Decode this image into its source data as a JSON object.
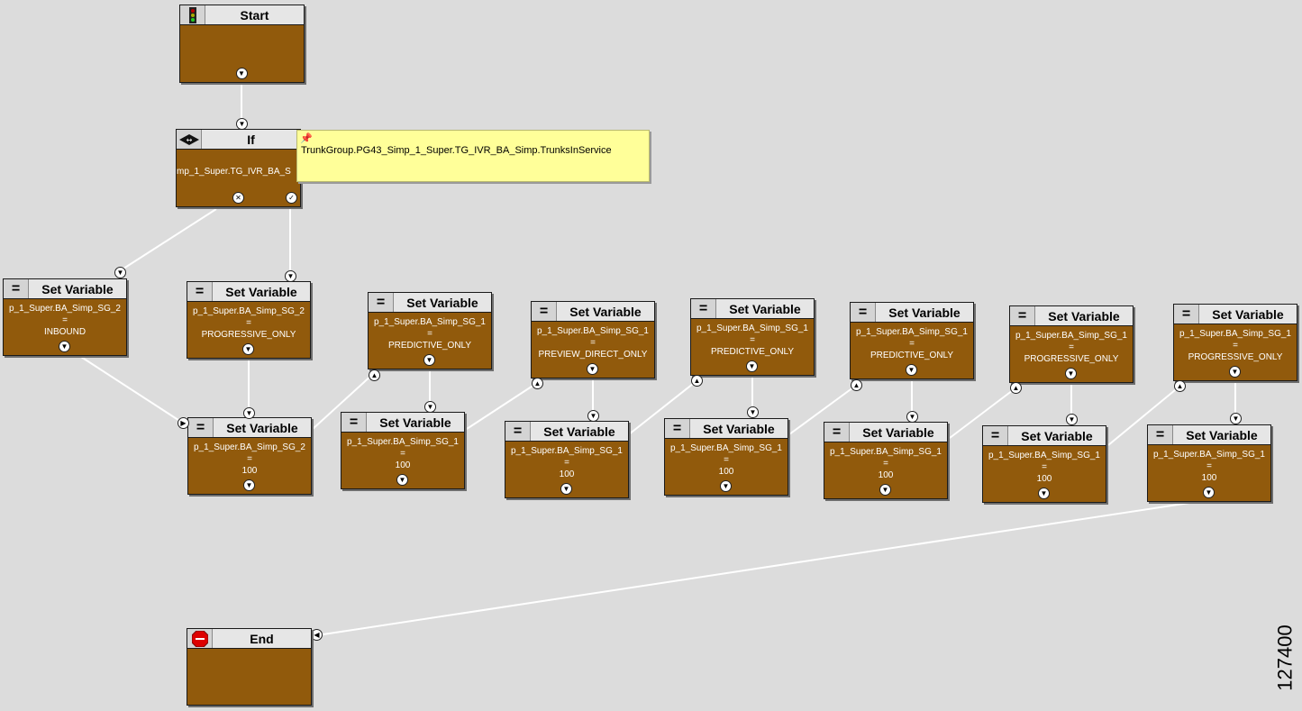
{
  "nodes": {
    "start": {
      "title": "Start"
    },
    "if": {
      "title": "If",
      "expression": "mp_1_Super.TG_IVR_BA_S"
    },
    "end": {
      "title": "End"
    },
    "set1": {
      "title": "Set Variable",
      "variable": "p_1_Super.BA_Simp_SG_2",
      "op": "=",
      "value": "INBOUND"
    },
    "set2": {
      "title": "Set Variable",
      "variable": "p_1_Super.BA_Simp_SG_2",
      "op": "=",
      "value": "PROGRESSIVE_ONLY"
    },
    "set3": {
      "title": "Set Variable",
      "variable": "p_1_Super.BA_Simp_SG_2",
      "op": "=",
      "value": "100"
    },
    "set4": {
      "title": "Set Variable",
      "variable": "p_1_Super.BA_Simp_SG_1",
      "op": "=",
      "value": "PREDICTIVE_ONLY"
    },
    "set5": {
      "title": "Set Variable",
      "variable": "p_1_Super.BA_Simp_SG_1",
      "op": "=",
      "value": "100"
    },
    "set6": {
      "title": "Set Variable",
      "variable": "p_1_Super.BA_Simp_SG_1",
      "op": "=",
      "value": "PREVIEW_DIRECT_ONLY"
    },
    "set7": {
      "title": "Set Variable",
      "variable": "p_1_Super.BA_Simp_SG_1",
      "op": "=",
      "value": "100"
    },
    "set8": {
      "title": "Set Variable",
      "variable": "p_1_Super.BA_Simp_SG_1",
      "op": "=",
      "value": "PREDICTIVE_ONLY"
    },
    "set9": {
      "title": "Set Variable",
      "variable": "p_1_Super.BA_Simp_SG_1",
      "op": "=",
      "value": "100"
    },
    "set10": {
      "title": "Set Variable",
      "variable": "p_1_Super.BA_Simp_SG_1",
      "op": "=",
      "value": "PREDICTIVE_ONLY"
    },
    "set11": {
      "title": "Set Variable",
      "variable": "p_1_Super.BA_Simp_SG_1",
      "op": "=",
      "value": "100"
    },
    "set12": {
      "title": "Set Variable",
      "variable": "p_1_Super.BA_Simp_SG_1",
      "op": "=",
      "value": "PROGRESSIVE_ONLY"
    },
    "set13": {
      "title": "Set Variable",
      "variable": "p_1_Super.BA_Simp_SG_1",
      "op": "=",
      "value": "100"
    },
    "set14": {
      "title": "Set Variable",
      "variable": "p_1_Super.BA_Simp_SG_1",
      "op": "=",
      "value": "PROGRESSIVE_ONLY"
    },
    "set15": {
      "title": "Set Variable",
      "variable": "p_1_Super.BA_Simp_SG_1",
      "op": "=",
      "value": "100"
    }
  },
  "tooltip": {
    "text": "TrunkGroup.PG43_Simp_1_Super.TG_IVR_BA_Simp.TrunksInService"
  },
  "figure_number": "127400",
  "icons": {
    "start": "traffic-light-icon",
    "if": "condition-diamond-icon",
    "set_variable": "equals-icon",
    "end": "stop-sign-icon",
    "false_exit": "x-icon",
    "true_exit": "check-icon",
    "tooltip": "pushpin-icon"
  },
  "colors": {
    "node_body": "#915a0c",
    "canvas": "#dcdcdc",
    "tooltip": "#ffff99",
    "wire": "#ffffff"
  }
}
